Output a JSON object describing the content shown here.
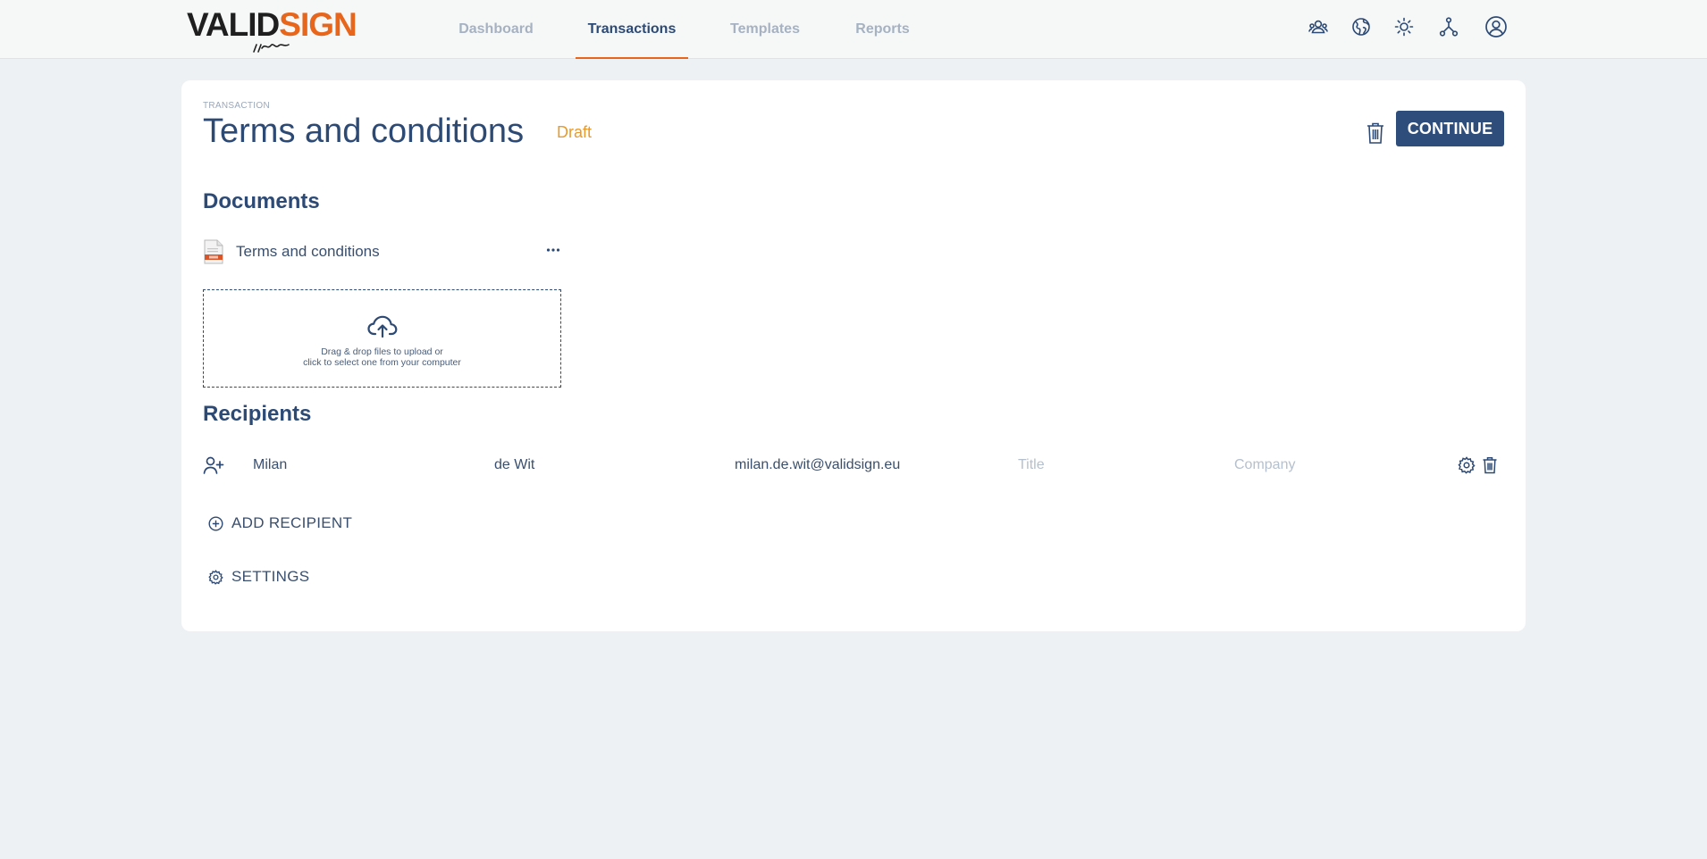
{
  "app": {
    "logo": {
      "part1": "VALID",
      "part2": "SIGN",
      "brand_orange": "#e8661c",
      "brand_dark": "#1f1f1f"
    },
    "nav": [
      {
        "label": "Dashboard",
        "active": false
      },
      {
        "label": "Transactions",
        "active": true
      },
      {
        "label": "Templates",
        "active": false
      },
      {
        "label": "Reports",
        "active": false
      }
    ],
    "header_icons": [
      "users-icon",
      "globe-icon",
      "sun-icon",
      "network-icon",
      "user-circle-icon"
    ]
  },
  "transaction": {
    "eyebrow": "TRANSACTION",
    "title": "Terms and conditions",
    "status": "Draft",
    "continue_label": "CONTINUE"
  },
  "documents": {
    "heading": "Documents",
    "items": [
      {
        "name": "Terms and conditions",
        "icon": "pdf-file-icon"
      }
    ],
    "dropzone": {
      "line1": "Drag & drop files to upload or",
      "line2": "click to select one from your computer"
    }
  },
  "recipients": {
    "heading": "Recipients",
    "rows": [
      {
        "first_name": "Milan",
        "last_name": "de Wit",
        "email": "milan.de.wit@validsign.eu",
        "title_placeholder": "Title",
        "company_placeholder": "Company"
      }
    ],
    "add_label": "ADD RECIPIENT",
    "settings_label": "SETTINGS"
  },
  "colors": {
    "primary": "#2e4d7b",
    "accent": "#e8661c",
    "draft": "#e89a2c",
    "background": "#eef1f4"
  }
}
